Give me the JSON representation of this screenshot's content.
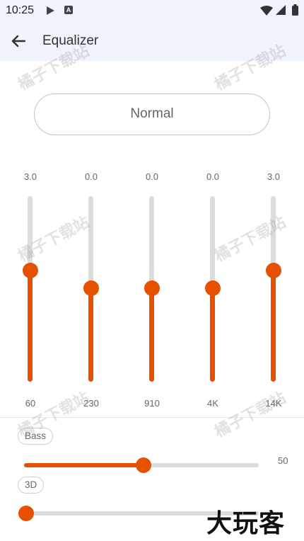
{
  "status_bar": {
    "time": "10:25",
    "icons": [
      "play-icon",
      "font-a-icon",
      "wifi-icon",
      "signal-icon",
      "battery-icon"
    ],
    "a_glyph": "A"
  },
  "app_bar": {
    "back_icon": "arrow-back-icon",
    "title": "Equalizer"
  },
  "preset": {
    "label": "Normal"
  },
  "equalizer": {
    "bands": [
      {
        "value": "3.0",
        "freq": "60",
        "level": 0.6
      },
      {
        "value": "0.0",
        "freq": "230",
        "level": 0.5
      },
      {
        "value": "0.0",
        "freq": "910",
        "level": 0.5
      },
      {
        "value": "0.0",
        "freq": "4K",
        "level": 0.5
      },
      {
        "value": "3.0",
        "freq": "14K",
        "level": 0.6
      }
    ]
  },
  "bass": {
    "label": "Bass",
    "value": "50",
    "level": 0.5
  },
  "threed": {
    "label": "3D",
    "level": 0.0
  },
  "watermark_text": "橘子下载站",
  "brand_logo_text": "大玩客",
  "colors": {
    "accent": "#e65100",
    "track": "#dcdcdc",
    "bar_bg": "#eff3fb"
  }
}
